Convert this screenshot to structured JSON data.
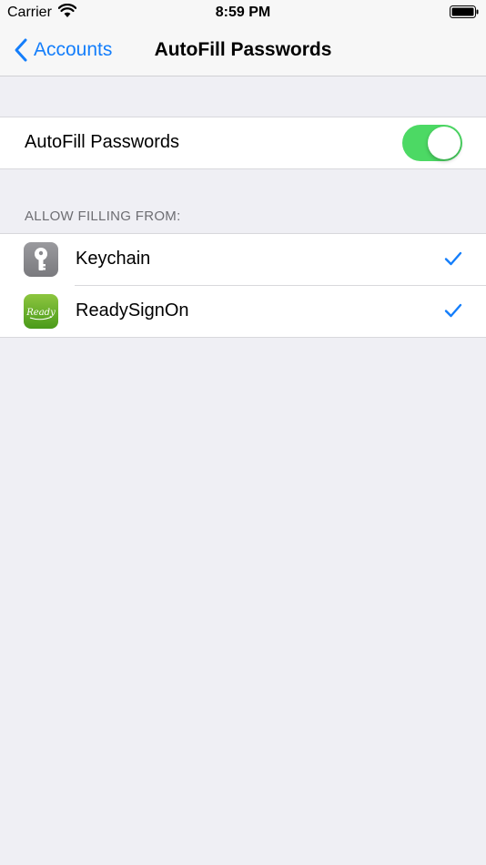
{
  "status_bar": {
    "carrier": "Carrier",
    "time": "8:59 PM"
  },
  "nav": {
    "back_label": "Accounts",
    "title": "AutoFill Passwords"
  },
  "autofill": {
    "label": "AutoFill Passwords",
    "enabled": true
  },
  "allow_section": {
    "header": "ALLOW FILLING FROM:",
    "items": [
      {
        "label": "Keychain",
        "icon": "keychain-icon",
        "checked": true
      },
      {
        "label": "ReadySignOn",
        "icon": "readysignon-app-icon",
        "checked": true
      }
    ],
    "ready_icon_text": "Ready"
  },
  "colors": {
    "accent": "#147efb",
    "toggle_on": "#4cd964",
    "background": "#efeff4"
  }
}
